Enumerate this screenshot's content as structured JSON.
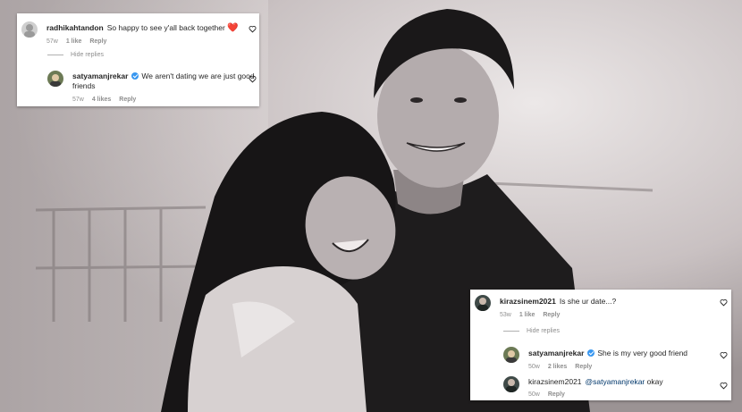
{
  "card_top": {
    "comment": {
      "username": "radhikahtandon",
      "text": "So happy to see y'all back together",
      "emoji": "❤️",
      "time": "57w",
      "likes": "1 like",
      "reply": "Reply"
    },
    "hide_replies": "Hide replies",
    "reply": {
      "username": "satyamanjrekar",
      "text_line1": "We aren't dating we are just good",
      "text_line2": "friends",
      "time": "57w",
      "likes": "4 likes",
      "reply": "Reply"
    }
  },
  "card_bottom": {
    "comment": {
      "username": "kirazsinem2021",
      "text": "Is she ur date...?",
      "time": "53w",
      "likes": "1 like",
      "reply": "Reply"
    },
    "hide_replies": "Hide replies",
    "reply1": {
      "username": "satyamanjrekar",
      "text": "She is my very good friend",
      "time": "50w",
      "likes": "2 likes",
      "reply": "Reply"
    },
    "reply2": {
      "username": "kirazsinem2021",
      "mention": "@satyamanjrekar",
      "text": "okay",
      "time": "50w",
      "reply": "Reply"
    }
  },
  "colors": {
    "verified": "#3897f0",
    "heart_emoji": "#ed1c3a",
    "meta_text": "#8e8e8e"
  },
  "icons": [
    "heart-outline-icon",
    "verified-badge-icon",
    "avatar"
  ]
}
